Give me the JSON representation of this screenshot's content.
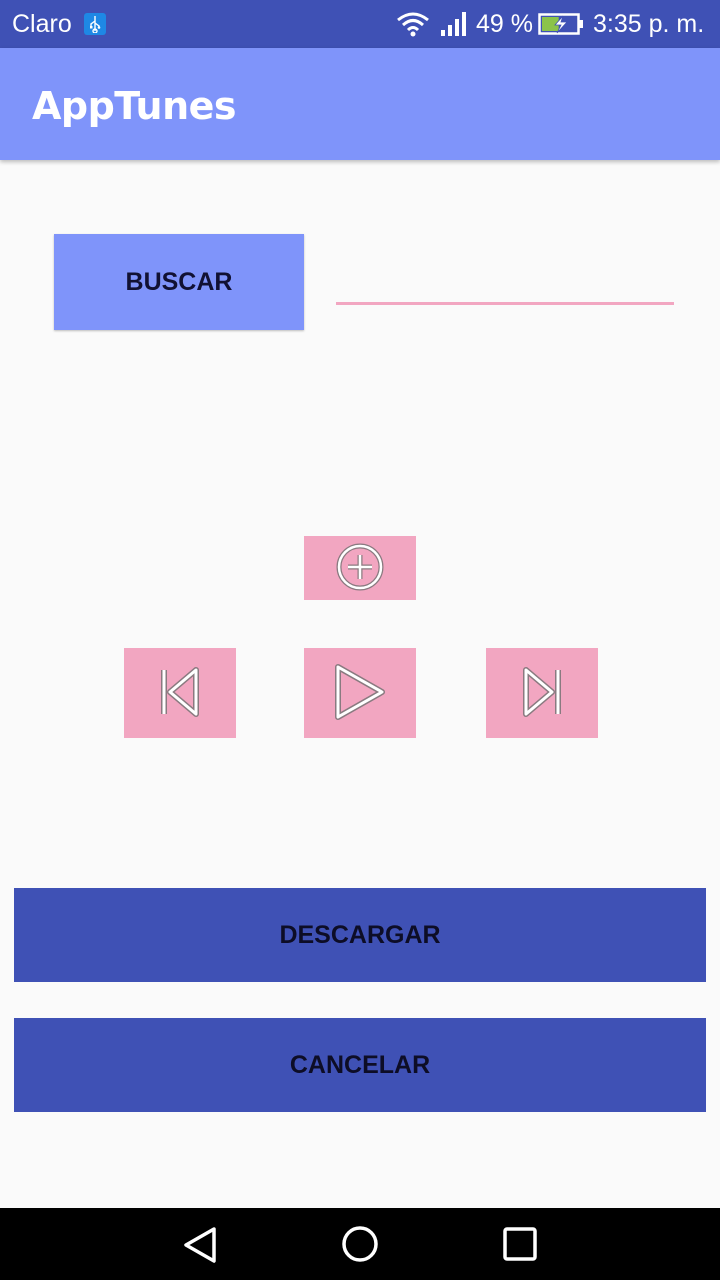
{
  "status_bar": {
    "carrier": "Claro",
    "battery_percent": "49 %",
    "time": "3:35 p. m.",
    "battery_level": 0.49,
    "icons": [
      "usb-icon",
      "wifi-icon",
      "signal-icon",
      "battery-charging-icon"
    ]
  },
  "app_bar": {
    "title": "AppTunes"
  },
  "search": {
    "button_label": "BUSCAR",
    "input_value": "",
    "input_placeholder": ""
  },
  "media_controls": {
    "add_icon": "add-circle-icon",
    "prev_icon": "skip-previous-icon",
    "play_icon": "play-icon",
    "next_icon": "skip-next-icon"
  },
  "actions": {
    "download_label": "DESCARGAR",
    "cancel_label": "CANCELAR"
  },
  "nav_bar": {
    "icons": [
      "back-icon",
      "home-icon",
      "recents-icon"
    ]
  },
  "colors": {
    "status_bar": "#3f51b5",
    "app_bar": "#7f94fa",
    "accent_pink": "#f2a6c1",
    "primary": "#3f51b5",
    "background": "#fafafa"
  }
}
